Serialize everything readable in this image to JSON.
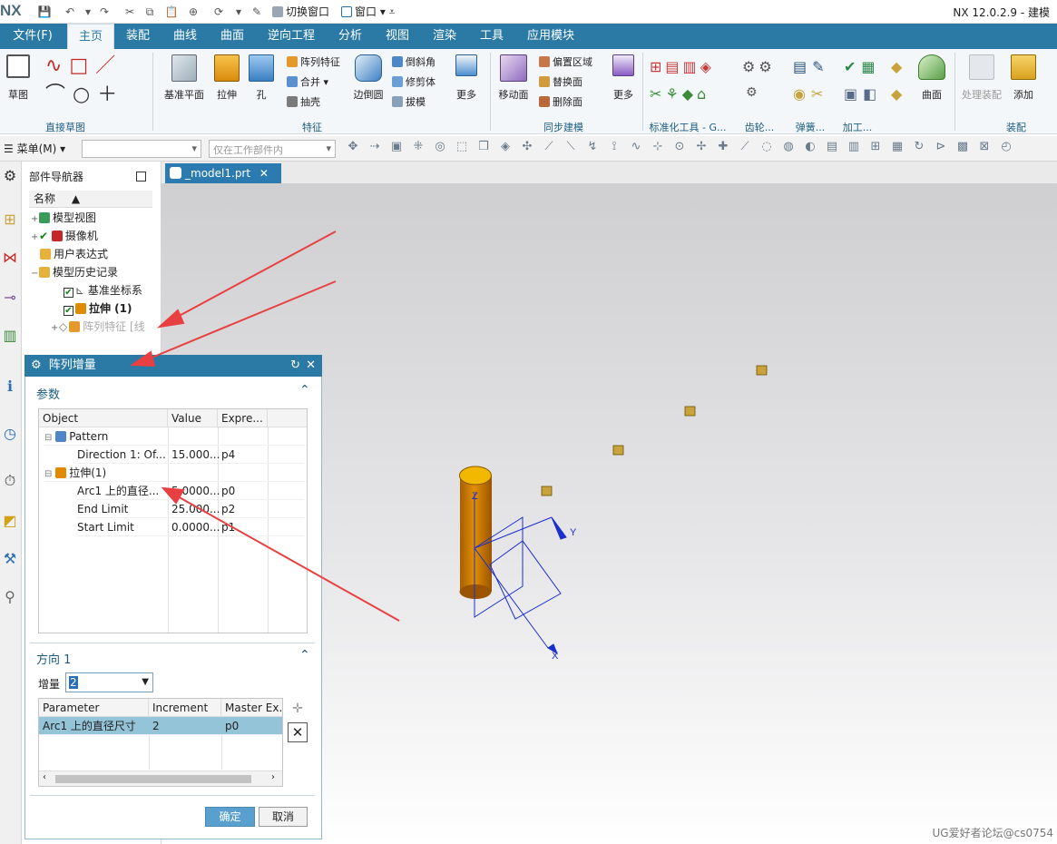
{
  "app": {
    "logo": "NX",
    "title": "NX 12.0.2.9 - 建模",
    "switch_window": "切换窗口",
    "window_menu": "窗口"
  },
  "menu": {
    "file": "文件(F)",
    "tabs": [
      "主页",
      "装配",
      "曲线",
      "曲面",
      "逆向工程",
      "分析",
      "视图",
      "渲染",
      "工具",
      "应用模块"
    ],
    "active_tab": "主页"
  },
  "ribbon": {
    "sketch": {
      "label": "草图",
      "group": "直接草图"
    },
    "feature": {
      "group": "特征",
      "datum_plane": "基准平面",
      "extrude": "拉伸",
      "hole": "孔",
      "pattern_feature": "阵列特征",
      "unite": "合并",
      "shell": "抽壳",
      "edge_blend": "边倒圆",
      "chamfer": "倒斜角",
      "trim_body": "修剪体",
      "draft": "拔模",
      "more": "更多"
    },
    "sync": {
      "group": "同步建模",
      "move_face": "移动面",
      "offset_region": "偏置区域",
      "replace_face": "替换面",
      "delete_face": "删除面",
      "more": "更多"
    },
    "standard_tools": "标准化工具 - G...",
    "gear": "齿轮...",
    "spring": "弹簧...",
    "machining": "加工...",
    "surface": {
      "label": "曲面"
    },
    "assembly": {
      "group": "装配",
      "process_assembly": "处理装配",
      "add": "添加"
    }
  },
  "commandbar": {
    "menu": "菜单(M)",
    "filter_placeholder": "仅在工作部件内"
  },
  "navigator": {
    "title": "部件导航器",
    "column": "名称",
    "items": [
      "模型视图",
      "摄像机",
      "用户表达式",
      "模型历史记录",
      "基准坐标系",
      "拉伸 (1)",
      "阵列特征 [线"
    ]
  },
  "viewport": {
    "tab": "_model1.prt",
    "axis_x": "X",
    "axis_y": "Y",
    "axis_z": "Z"
  },
  "dialog": {
    "title": "阵列增量",
    "params_section": "参数",
    "params_columns": [
      "Object",
      "Value",
      "Expre..."
    ],
    "params_rows": [
      {
        "object": "Pattern",
        "value": "",
        "expr": ""
      },
      {
        "object": "Direction 1: Of...",
        "value": "15.000...",
        "expr": "p4"
      },
      {
        "object": "拉伸(1)",
        "value": "",
        "expr": ""
      },
      {
        "object": "Arc1 上的直径...",
        "value": "5.0000...",
        "expr": "p0"
      },
      {
        "object": "End Limit",
        "value": "25.000...",
        "expr": "p2"
      },
      {
        "object": "Start Limit",
        "value": "0.0000...",
        "expr": "p1"
      }
    ],
    "direction_section": "方向 1",
    "increment_label": "增量",
    "increment_value": "2",
    "inc_columns": [
      "Parameter",
      "Increment",
      "Master Ex..."
    ],
    "inc_rows": [
      {
        "parameter": "Arc1 上的直径尺寸",
        "increment": "2",
        "master": "p0"
      }
    ],
    "ok": "确定",
    "cancel": "取消"
  },
  "colors": {
    "accent": "#2a7aa5",
    "selection": "#93c4d8",
    "arrow": "#e84040",
    "cylinder": "#e08a00"
  },
  "watermark": "UG爱好者论坛@cs0754"
}
